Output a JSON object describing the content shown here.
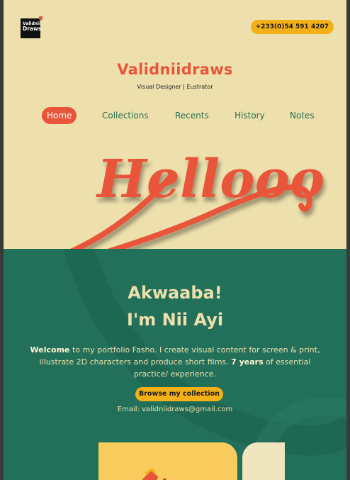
{
  "header": {
    "logo_line1": "Validnii",
    "logo_line2": "Draws",
    "phone": "+233(0)54 591 4207"
  },
  "brand": {
    "title": "Validniidraws",
    "tagline": "Visual Designer | Eustrator"
  },
  "nav": {
    "items": [
      {
        "label": "Home",
        "active": true
      },
      {
        "label": "Collections"
      },
      {
        "label": "Recents"
      },
      {
        "label": "History"
      },
      {
        "label": "Notes"
      }
    ]
  },
  "hero": {
    "art_text": "Hellooo",
    "art_color": "#e8553a"
  },
  "intro": {
    "greeting_line1": "Akwaaba!",
    "greeting_line2": "I'm Nii Ayi",
    "bold_start": "Welcome",
    "text_part1": " to my portfolio Fasho. I create visual content for screen & print, illustrate 2D characters and produce short films. ",
    "bold_years": "7 years",
    "text_part2": " of essential practice/ experience.",
    "browse_label": "Browse my collection",
    "email": "Email: validniidraws@gmail.com"
  },
  "colors": {
    "cream": "#ede0ac",
    "green": "#23705a",
    "orange": "#e8553a",
    "yellow": "#f3b019"
  }
}
